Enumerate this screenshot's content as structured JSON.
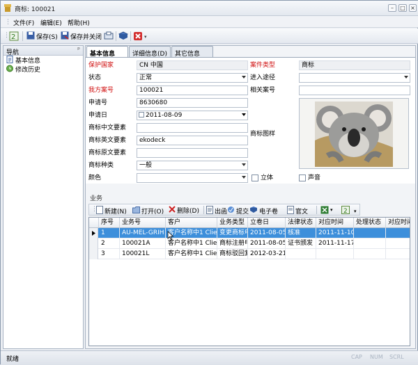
{
  "window": {
    "title": "商标: 100021"
  },
  "menu": [
    "文件(F)",
    "编辑(E)",
    "帮助(H)"
  ],
  "toolbar": {
    "save": "保存(S)",
    "save_close": "保存并关闭"
  },
  "nav": {
    "title": "导航",
    "pin": "ᵖ",
    "items": [
      "基本信息",
      "修改历史"
    ]
  },
  "tabs": [
    "基本信息(B)",
    "详细信息(D)",
    "其它信息(O)"
  ],
  "form": {
    "protect_country_label": "保护国家",
    "protect_country_value": "CN 中国",
    "case_type_label": "案件类型",
    "case_type_value": "商标",
    "status_label": "状态",
    "status_value": "正常",
    "channel_label": "进入途径",
    "channel_value": "",
    "our_ref_label": "我方案号",
    "our_ref_value": "100021",
    "related_ref_label": "相关案号",
    "related_ref_value": "",
    "app_no_label": "申请号",
    "app_no_value": "8630680",
    "app_date_label": "申请日",
    "app_date_value": "2011-08-09",
    "cn_element_label": "商标中文要素",
    "cn_element_value": "",
    "en_element_label": "商标英文要素",
    "en_element_value": "ekodeck",
    "orig_element_label": "商标原文要素",
    "orig_element_value": "",
    "tm_type_label": "商标种类",
    "tm_type_value": "一般",
    "color_label": "颜色",
    "color_value": "",
    "pattern_label": "商标图样",
    "solid_label": "立体",
    "sound_label": "声音"
  },
  "business": {
    "title": "业务",
    "toolbar": [
      "新建(N)",
      "打开(O)",
      "删除(D)",
      "出函",
      "提交",
      "电子卷",
      "官文"
    ],
    "columns": [
      "序号",
      "业务号",
      "客户",
      "业务类型",
      "立卷日",
      "法律状态",
      "对应时间",
      "处理状态",
      "对应时间"
    ],
    "rows": [
      [
        "1",
        "AU-MEL-GRIH",
        "客户名称中1 Clie",
        "变更商标申",
        "2011-08-05",
        "核准",
        "2011-11-10",
        "",
        ""
      ],
      [
        "2",
        "100021A",
        "客户名称中1 Clie",
        "商标注册申",
        "2011-08-05",
        "证书颁发",
        "2011-11-17",
        "",
        ""
      ],
      [
        "3",
        "100021L",
        "客户名称中1 Clie",
        "商标驳回复",
        "2012-03-21",
        "",
        "",
        "",
        ""
      ]
    ]
  },
  "status": {
    "text": "就绪",
    "indicators": [
      "CAP",
      "NUM",
      "SCRL"
    ]
  },
  "colors": {
    "accent": "#3d8fdb",
    "required_label": "#d01010"
  }
}
